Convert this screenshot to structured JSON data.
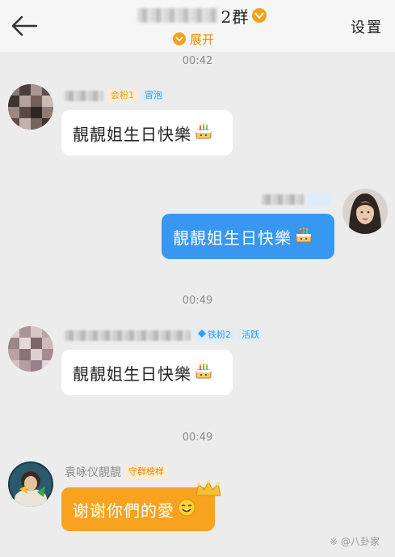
{
  "header": {
    "title_suffix": "2群",
    "expand_label": "展开",
    "settings_label": "设置"
  },
  "messages": [
    {
      "time": "00:42",
      "tags": [
        "会粉1",
        "冒泡"
      ],
      "text": "靚靚姐生日快樂",
      "emoji": "cake-icon"
    },
    {
      "text": "靚靚姐生日快樂",
      "emoji": "cake-icon",
      "self": true
    },
    {
      "time": "00:49",
      "tags": [
        "铁粉2",
        "活跃"
      ],
      "text": "靚靚姐生日快樂",
      "emoji": "cake-icon"
    },
    {
      "time": "00:49",
      "nickname": "袁咏仪靚靚",
      "tags": [
        "守群榜样"
      ],
      "text": "谢谢你們的愛",
      "emoji": "smile-icon"
    }
  ],
  "watermark": "※ @八卦家",
  "colors": {
    "accent": "#f0a318",
    "self_bubble": "#3897f0",
    "owner_bubble": "#f7a31f",
    "background": "#ececec"
  }
}
